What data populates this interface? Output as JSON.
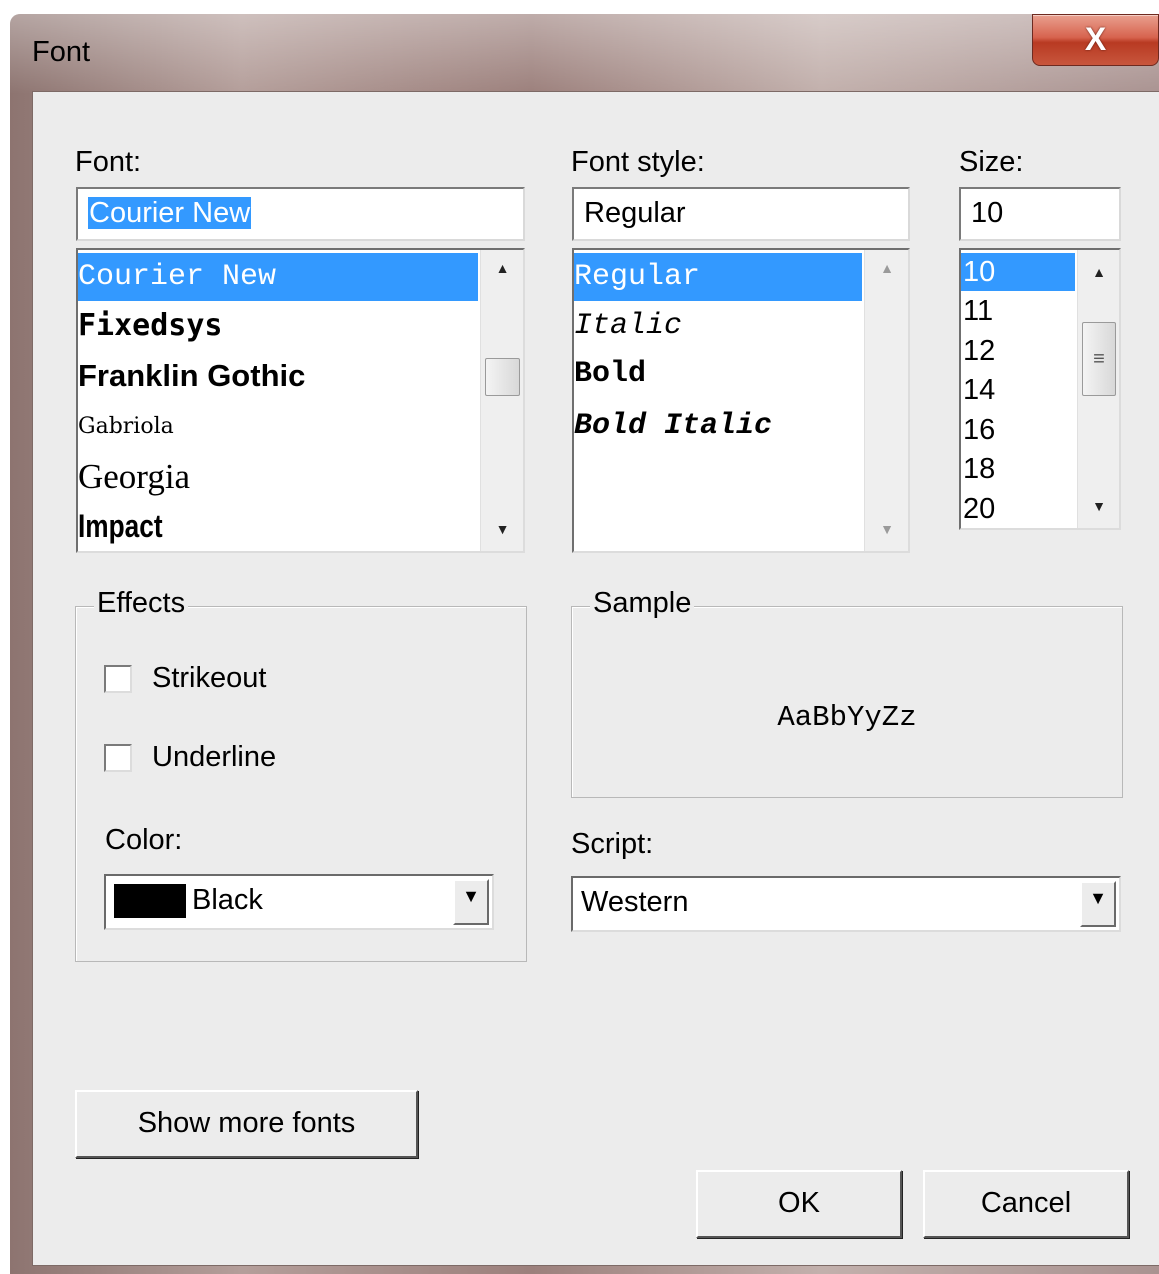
{
  "window": {
    "title": "Font",
    "close_label": "X"
  },
  "font": {
    "label": "Font:",
    "value": "Courier New",
    "items": [
      "Courier New",
      "Fixedsys",
      "Franklin Gothic",
      "Gabriola",
      "Georgia",
      "Impact"
    ],
    "selected_index": 0
  },
  "font_style": {
    "label": "Font style:",
    "value": "Regular",
    "items": [
      "Regular",
      "Italic",
      "Bold",
      "Bold Italic"
    ],
    "selected_index": 0
  },
  "size": {
    "label": "Size:",
    "value": "10",
    "items": [
      "10",
      "11",
      "12",
      "14",
      "16",
      "18",
      "20"
    ],
    "selected_index": 0
  },
  "effects": {
    "label": "Effects",
    "strikeout": {
      "label": "Strikeout",
      "checked": false
    },
    "underline": {
      "label": "Underline",
      "checked": false
    },
    "color_label": "Color:",
    "color_value": "Black",
    "color_swatch": "#000000"
  },
  "sample": {
    "label": "Sample",
    "text": "AaBbYyZz"
  },
  "script": {
    "label": "Script:",
    "value": "Western"
  },
  "buttons": {
    "show_more": "Show more fonts",
    "ok": "OK",
    "cancel": "Cancel"
  },
  "icons": {
    "scroll_up": "▲",
    "scroll_down": "▼",
    "combo_arrow": "▼",
    "thumb_grip": "≡"
  },
  "colors": {
    "selection": "#3399ff",
    "dialog_bg": "#ececec",
    "close_button": "#c8563d"
  }
}
